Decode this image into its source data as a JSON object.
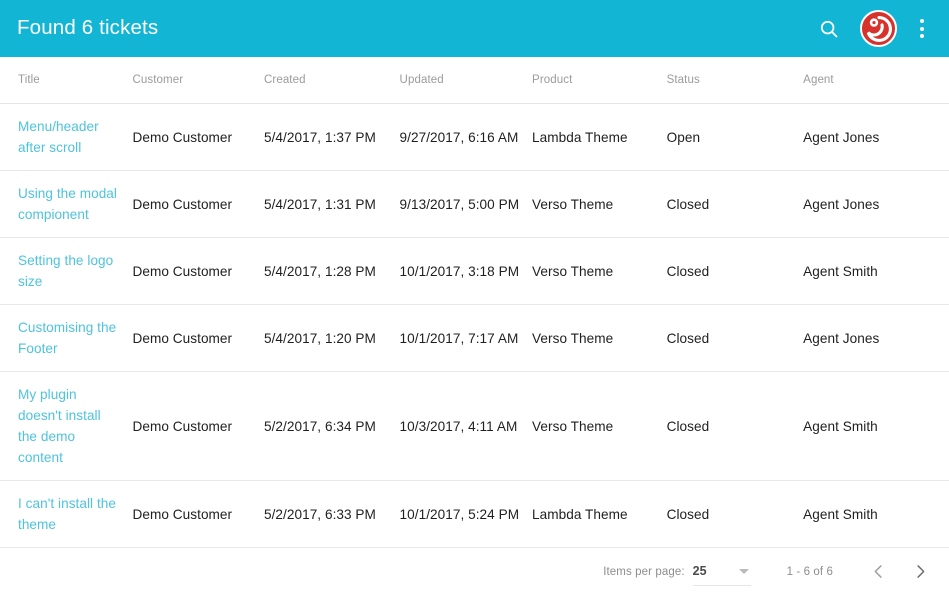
{
  "toolbar": {
    "title": "Found 6 tickets",
    "search_icon": "search-icon",
    "avatar_icon": "user-avatar-logo",
    "menu_icon": "kebab-menu-icon"
  },
  "table": {
    "columns": [
      "Title",
      "Customer",
      "Created",
      "Updated",
      "Product",
      "Status",
      "Agent"
    ],
    "rows": [
      {
        "title": "Menu/header after scroll",
        "customer": "Demo Customer",
        "created": "5/4/2017, 1:37 PM",
        "updated": "9/27/2017, 6:16 AM",
        "product": "Lambda Theme",
        "status": "Open",
        "agent": "Agent Jones"
      },
      {
        "title": "Using the modal compionent",
        "customer": "Demo Customer",
        "created": "5/4/2017, 1:31 PM",
        "updated": "9/13/2017, 5:00 PM",
        "product": "Verso Theme",
        "status": "Closed",
        "agent": "Agent Jones"
      },
      {
        "title": "Setting the logo size",
        "customer": "Demo Customer",
        "created": "5/4/2017, 1:28 PM",
        "updated": "10/1/2017, 3:18 PM",
        "product": "Verso Theme",
        "status": "Closed",
        "agent": "Agent Smith"
      },
      {
        "title": "Customising the Footer",
        "customer": "Demo Customer",
        "created": "5/4/2017, 1:20 PM",
        "updated": "10/1/2017, 7:17 AM",
        "product": "Verso Theme",
        "status": "Closed",
        "agent": "Agent Jones"
      },
      {
        "title": "My plugin doesn't install the demo content",
        "customer": "Demo Customer",
        "created": "5/2/2017, 6:34 PM",
        "updated": "10/3/2017, 4:11 AM",
        "product": "Verso Theme",
        "status": "Closed",
        "agent": "Agent Smith"
      },
      {
        "title": "I can't install the theme",
        "customer": "Demo Customer",
        "created": "5/2/2017, 6:33 PM",
        "updated": "10/1/2017, 5:24 PM",
        "product": "Lambda Theme",
        "status": "Closed",
        "agent": "Agent Smith"
      }
    ]
  },
  "paginator": {
    "items_per_page_label": "Items per page:",
    "items_per_page_value": "25",
    "range_label": "1 - 6 of 6",
    "prev_icon": "chevron-left-icon",
    "next_icon": "chevron-right-icon",
    "dropdown_icon": "chevron-down-icon"
  },
  "colors": {
    "toolbar_background": "#12b5d3",
    "link": "#4ec3dd",
    "avatar_background": "#d6332c",
    "header_text": "#9b9b9b",
    "body_text": "#1f1f1f"
  }
}
